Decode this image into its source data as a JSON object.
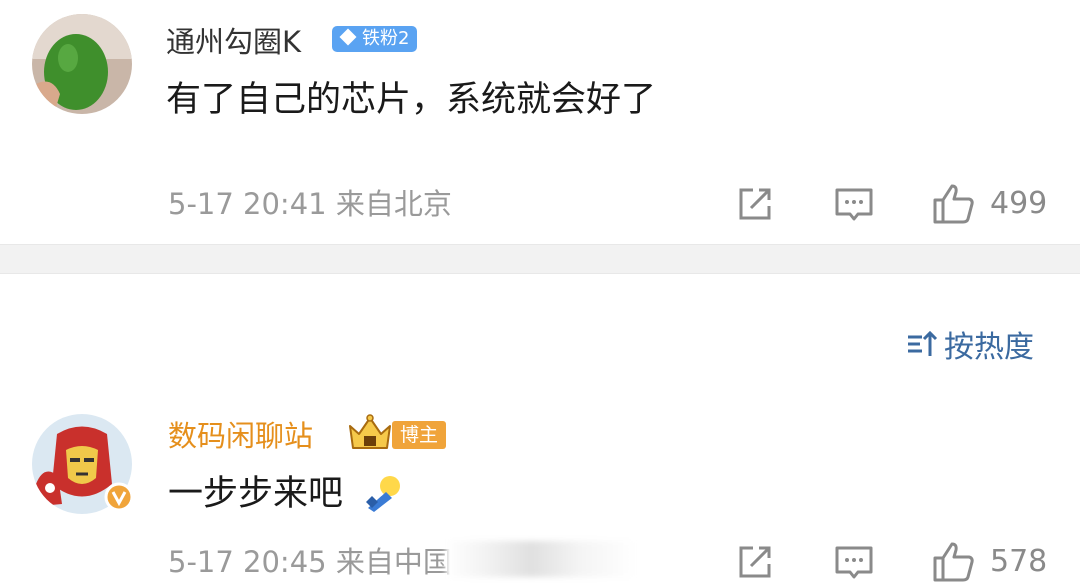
{
  "comment1": {
    "username": "通州勾圈K",
    "fan_badge": "铁粉2",
    "content": "有了自己的芯片，系统就会好了",
    "meta": "5-17 20:41  来自北京",
    "likes": "499"
  },
  "sort": {
    "label": "按热度"
  },
  "comment2": {
    "username": "数码闲聊站",
    "blogger_badge": "博主",
    "content": "一步步来吧",
    "meta": "5-17 20:45  来自中国",
    "likes": "578"
  },
  "icons": {
    "share": "share-icon",
    "comment": "comment-icon",
    "like": "thumbs-up-icon",
    "sort": "sort-icon",
    "crown": "crown-icon",
    "verified": "verified-v-icon",
    "emoji": "emoji-icon"
  },
  "colors": {
    "username_default": "#333333",
    "username_blogger": "#e58f1c",
    "fan_badge": "#5aa3f2",
    "blogger_badge": "#f0a43a",
    "sort_link": "#3b6aa0",
    "meta_gray": "#9a9a9a",
    "divider": "#f2f2f2"
  }
}
